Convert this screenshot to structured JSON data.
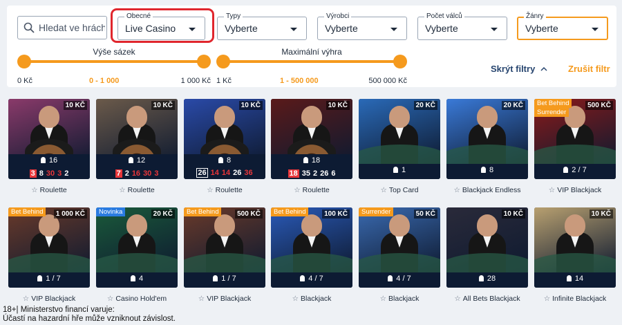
{
  "filters": {
    "search_placeholder": "Hledat ve hrách",
    "general": {
      "label": "Obecné",
      "value": "Live Casino"
    },
    "types": {
      "label": "Typy",
      "value": "Vyberte"
    },
    "producers": {
      "label": "Výrobci",
      "value": "Vyberte"
    },
    "reels": {
      "label": "Počet válců",
      "value": "Vyberte"
    },
    "genres": {
      "label": "Žánry",
      "value": "Vyberte"
    },
    "bet_size": {
      "label": "Výše sázek",
      "min": "0 Kč",
      "range": "0 - 1 000",
      "max": "1 000 Kč"
    },
    "max_win": {
      "label": "Maximální výhra",
      "min": "1 Kč",
      "range": "1 - 500 000",
      "max": "500 000 Kč"
    },
    "hide_label": "Skrýt filtry",
    "clear_label": "Zrušit filtr"
  },
  "games": [
    {
      "name": "Roulette",
      "price": "10 KČ",
      "players": "16",
      "results": [
        {
          "v": "3",
          "s": "redbg"
        },
        {
          "v": "8",
          "s": ""
        },
        {
          "v": "30",
          "s": "red"
        },
        {
          "v": "3",
          "s": "red"
        },
        {
          "v": "2",
          "s": ""
        }
      ],
      "theme": "#8a3a6a"
    },
    {
      "name": "Roulette",
      "price": "10 KČ",
      "players": "12",
      "results": [
        {
          "v": "7",
          "s": "redbg"
        },
        {
          "v": "2",
          "s": ""
        },
        {
          "v": "16",
          "s": "red"
        },
        {
          "v": "30",
          "s": "red"
        },
        {
          "v": "3",
          "s": "red"
        }
      ],
      "theme": "#6b5a4a"
    },
    {
      "name": "Roulette",
      "price": "10 KČ",
      "players": "8",
      "results": [
        {
          "v": "26",
          "s": "box"
        },
        {
          "v": "14",
          "s": "red"
        },
        {
          "v": "14",
          "s": "red"
        },
        {
          "v": "26",
          "s": ""
        },
        {
          "v": "36",
          "s": "red"
        }
      ],
      "theme": "#2a4aa8"
    },
    {
      "name": "Roulette",
      "price": "10 KČ",
      "players": "18",
      "results": [
        {
          "v": "18",
          "s": "redbg"
        },
        {
          "v": "35",
          "s": ""
        },
        {
          "v": "2",
          "s": ""
        },
        {
          "v": "26",
          "s": ""
        },
        {
          "v": "6",
          "s": ""
        }
      ],
      "theme": "#5a1a1a"
    },
    {
      "name": "Top Card",
      "price": "20 KČ",
      "players": "1",
      "results": [],
      "theme": "#2a6ab8"
    },
    {
      "name": "Blackjack Endless",
      "price": "20 KČ",
      "players": "8",
      "results": [],
      "theme": "#3a7ad8"
    },
    {
      "name": "VIP Blackjack",
      "price": "500 KČ",
      "players": "2 / 7",
      "badges": [
        "Bet Behind",
        "Surrender"
      ],
      "results": [],
      "theme": "#8a1a1a"
    },
    {
      "name": "VIP Blackjack",
      "price": "1 000 KČ",
      "players": "1 / 7",
      "badges": [
        "Bet Behind"
      ],
      "results": [],
      "theme": "#6a3a2a"
    },
    {
      "name": "Casino Hold'em",
      "price": "20 KČ",
      "players": "4",
      "badges": [
        "Novinka"
      ],
      "results": [],
      "theme": "#1a5a3a"
    },
    {
      "name": "VIP Blackjack",
      "price": "500 KČ",
      "players": "1 / 7",
      "badges": [
        "Bet Behind"
      ],
      "results": [],
      "theme": "#6a3a2a"
    },
    {
      "name": "Blackjack",
      "price": "100 KČ",
      "players": "4 / 7",
      "badges": [
        "Bet Behind"
      ],
      "results": [],
      "theme": "#2a5ab8"
    },
    {
      "name": "Blackjack",
      "price": "50 KČ",
      "players": "4 / 7",
      "badges": [
        "Surrender"
      ],
      "results": [],
      "theme": "#3a6ab0"
    },
    {
      "name": "All Bets Blackjack",
      "price": "10 KČ",
      "players": "28",
      "results": [],
      "theme": "#2a2a3a"
    },
    {
      "name": "Infinite Blackjack",
      "price": "10 KČ",
      "players": "14",
      "results": [],
      "theme": "#b8a070"
    }
  ],
  "disclaimer": {
    "line1": "18+| Ministerstvo financí varuje:",
    "line2": "Účastí na hazardní hře může vzniknout závislost."
  },
  "colors": {
    "accent": "#f59a1d",
    "highlight_ring": "#e0262d",
    "card_bar": "#0d1b33"
  },
  "icons": {
    "search": "search-icon",
    "caret": "chevron-down-icon",
    "star": "star-icon",
    "player": "player-icon"
  }
}
